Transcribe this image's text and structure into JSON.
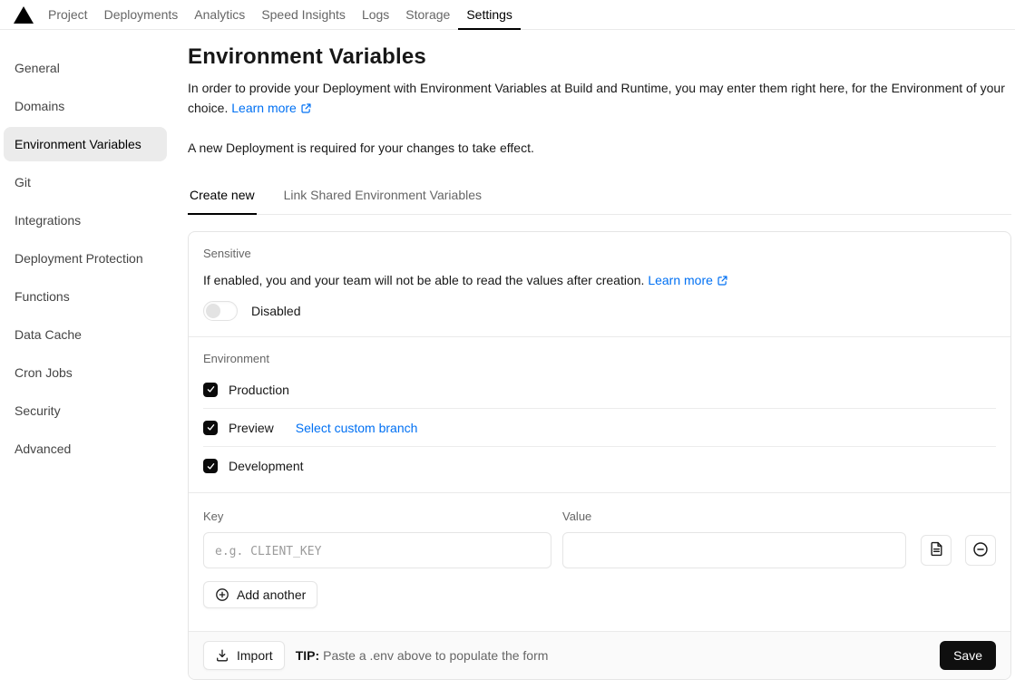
{
  "header": {
    "nav": [
      {
        "label": "Project",
        "active": false
      },
      {
        "label": "Deployments",
        "active": false
      },
      {
        "label": "Analytics",
        "active": false
      },
      {
        "label": "Speed Insights",
        "active": false
      },
      {
        "label": "Logs",
        "active": false
      },
      {
        "label": "Storage",
        "active": false
      },
      {
        "label": "Settings",
        "active": true
      }
    ]
  },
  "sidebar": {
    "items": [
      {
        "label": "General",
        "active": false
      },
      {
        "label": "Domains",
        "active": false
      },
      {
        "label": "Environment Variables",
        "active": true
      },
      {
        "label": "Git",
        "active": false
      },
      {
        "label": "Integrations",
        "active": false
      },
      {
        "label": "Deployment Protection",
        "active": false
      },
      {
        "label": "Functions",
        "active": false
      },
      {
        "label": "Data Cache",
        "active": false
      },
      {
        "label": "Cron Jobs",
        "active": false
      },
      {
        "label": "Security",
        "active": false
      },
      {
        "label": "Advanced",
        "active": false
      }
    ]
  },
  "main": {
    "title": "Environment Variables",
    "description": "In order to provide your Deployment with Environment Variables at Build and Runtime, you may enter them right here, for the Environment of your choice.",
    "learn_more_label": "Learn more",
    "deployment_note": "A new Deployment is required for your changes to take effect.",
    "tabs": [
      {
        "label": "Create new",
        "active": true
      },
      {
        "label": "Link Shared Environment Variables",
        "active": false
      }
    ]
  },
  "card": {
    "sensitive": {
      "label": "Sensitive",
      "description": "If enabled, you and your team will not be able to read the values after creation.",
      "learn_more_label": "Learn more",
      "toggle_on": false,
      "toggle_state": "Disabled"
    },
    "environment": {
      "label": "Environment",
      "options": [
        {
          "label": "Production",
          "checked": true
        },
        {
          "label": "Preview",
          "checked": true,
          "link": "Select custom branch"
        },
        {
          "label": "Development",
          "checked": true
        }
      ]
    },
    "kv": {
      "key_label": "Key",
      "key_placeholder": "e.g. CLIENT_KEY",
      "key_value": "",
      "value_label": "Value",
      "value_value": "",
      "add_another_label": "Add another"
    },
    "footer": {
      "import_label": "Import",
      "tip_label": "TIP:",
      "tip_text": "Paste a .env above to populate the form",
      "save_label": "Save"
    }
  },
  "icons": {
    "vercel-logo": "black-triangle",
    "external-link-icon": "box-with-arrow-up-right",
    "checkbox-check-icon": "white-checkmark",
    "paste-document-icon": "file-with-lines",
    "remove-row-icon": "circle-minus",
    "add-icon": "circle-plus",
    "import-download-icon": "arrow-down-to-tray"
  },
  "colors": {
    "link_blue": "#0070f3",
    "save_button_bg": "#0f0f0f",
    "checkbox_bg": "#0a0a0a",
    "active_sidebar_bg": "#ebebeb",
    "footer_bg": "#fafafa",
    "border": "#e5e5e5"
  }
}
